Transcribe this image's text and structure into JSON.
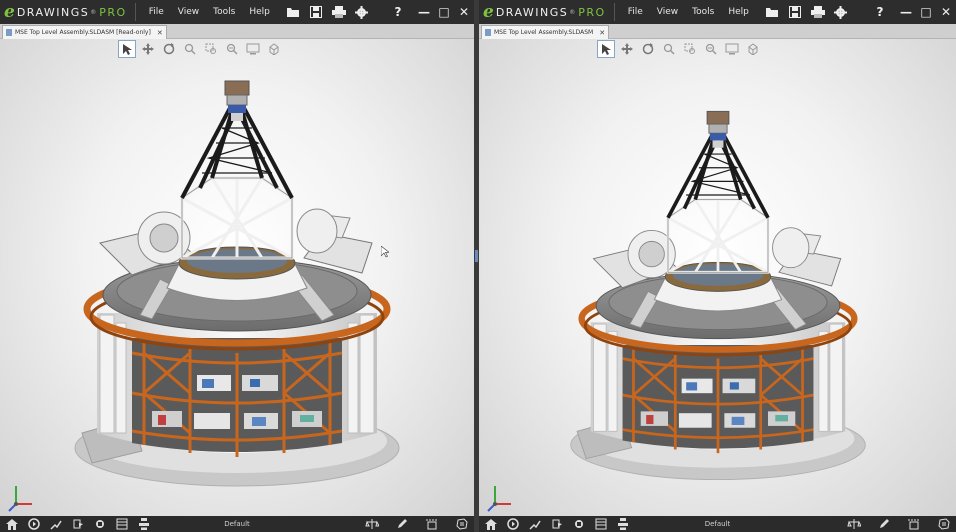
{
  "app": {
    "logo_word": "DRAWINGS",
    "logo_reg": "®",
    "logo_edition": "PRO"
  },
  "menus": [
    "File",
    "View",
    "Tools",
    "Help"
  ],
  "left": {
    "tab_title": "MSE Top Level Assembly.SLDASM [Read-only]",
    "configuration": "Default"
  },
  "right": {
    "tab_title": "MSE Top Level Assembly.SLDASM",
    "configuration": "Default"
  },
  "colors": {
    "titlebar": "#2d2d2d",
    "accent_green": "#7ec242",
    "steel_orange": "#c8661e",
    "truss_black": "#1b1b1b",
    "structure_white": "#f0f0f0"
  },
  "icons": {
    "toolbar": [
      "open-icon",
      "save-icon",
      "print-icon",
      "settings-icon"
    ],
    "hud": [
      "select-icon",
      "pan-icon",
      "rotate-icon",
      "zoom-icon",
      "zoom-area-icon",
      "zoom-fit-icon",
      "display-style-icon",
      "view-orientation-icon"
    ],
    "bottom": [
      "home-icon",
      "play-icon",
      "animate-icon",
      "walkthrough-icon",
      "record-icon",
      "components-icon",
      "explode-icon"
    ],
    "bottom_right": [
      "measure-icon",
      "markup-icon",
      "section-icon",
      "stamp-icon"
    ]
  }
}
